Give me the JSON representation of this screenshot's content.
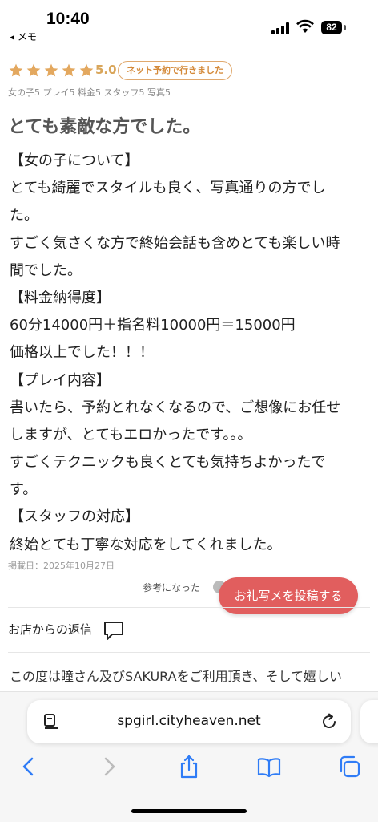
{
  "status": {
    "time": "10:40",
    "back_app": "◂ メモ",
    "battery": "82"
  },
  "review": {
    "stars": 5,
    "rating": "5.0",
    "badge": "ネット予約で行きました",
    "scores": "女の子5 プレイ5 料金5 スタッフ5 写真5",
    "title": "とても素敵な方でした。",
    "lines": [
      "【女の子について】",
      "とても綺麗でスタイルも良く、写真通りの方でし",
      "た。",
      "すごく気さくな方で終始会話も含めとても楽しい時",
      "間でした。",
      "【料金納得度】",
      "60分14000円＋指名料10000円＝15000円",
      "価格以上でした！！！",
      "【プレイ内容】",
      "書いたら、予約とれなくなるので、ご想像にお任せ",
      "しますが、とてもエロかったです。。。",
      "すごくテクニックも良くとても気持ちよかったで",
      "す。",
      "【スタッフの対応】",
      "終始とても丁寧な対応をしてくれました。"
    ],
    "posted": "掲載日：2025年10月27日",
    "helpful": "参考になった"
  },
  "photo_button": "お礼写メを投稿する",
  "shop_reply": {
    "label": "お店からの返信",
    "text": "この度は瞳さん及びSAKURAをご利用頂き、そして嬉しい"
  },
  "browser": {
    "url": "spgirl.cityheaven.net"
  },
  "colors": {
    "star": "#e3a85f",
    "badge": "#d48a3a",
    "accent_button": "#e15e5e",
    "toolbar_icon": "#2f7cf6"
  },
  "icons": {
    "comment": "comment-icon",
    "page": "page-icon",
    "reload": "reload-icon",
    "back": "back-icon",
    "forward": "forward-icon",
    "share": "share-icon",
    "bookmarks": "bookmarks-icon",
    "tabs": "tabs-icon"
  }
}
